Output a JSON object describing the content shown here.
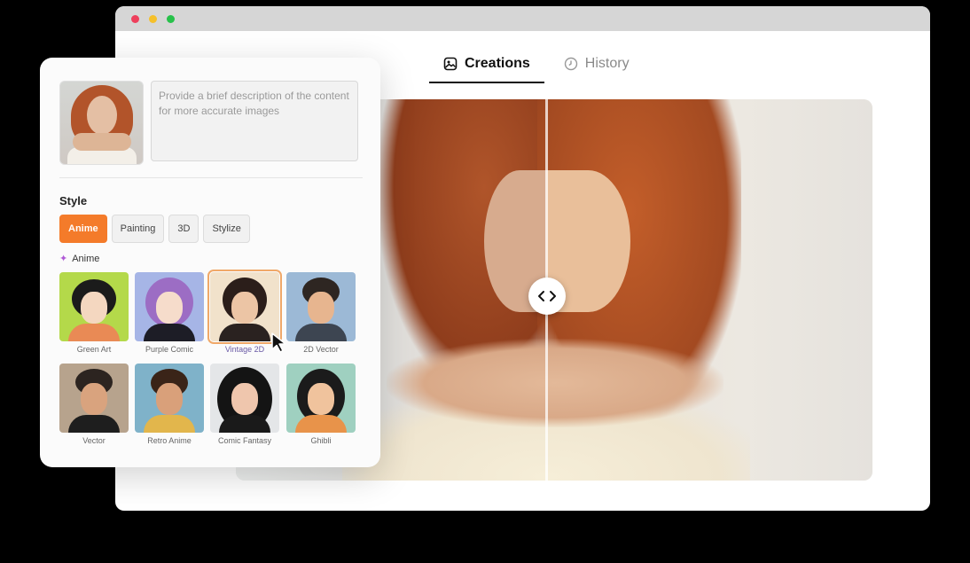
{
  "window": {
    "tabs": [
      {
        "label": "Creations",
        "icon": "image-icon",
        "active": true
      },
      {
        "label": "History",
        "icon": "clock-icon",
        "active": false
      }
    ]
  },
  "panel": {
    "description_placeholder": "Provide a brief description of the content for more accurate images",
    "style_label": "Style",
    "style_buttons": [
      {
        "label": "Anime",
        "active": true
      },
      {
        "label": "Painting",
        "active": false
      },
      {
        "label": "3D",
        "active": false
      },
      {
        "label": "Stylize",
        "active": false
      }
    ],
    "sub_label": "Anime",
    "styles": [
      {
        "label": "Green Art"
      },
      {
        "label": "Purple Comic"
      },
      {
        "label": "Vintage 2D",
        "selected": true
      },
      {
        "label": "2D Vector"
      },
      {
        "label": "Vector"
      },
      {
        "label": "Retro Anime"
      },
      {
        "label": "Comic Fantasy"
      },
      {
        "label": "Ghibli"
      }
    ]
  },
  "colors": {
    "accent": "#f47b2a"
  }
}
